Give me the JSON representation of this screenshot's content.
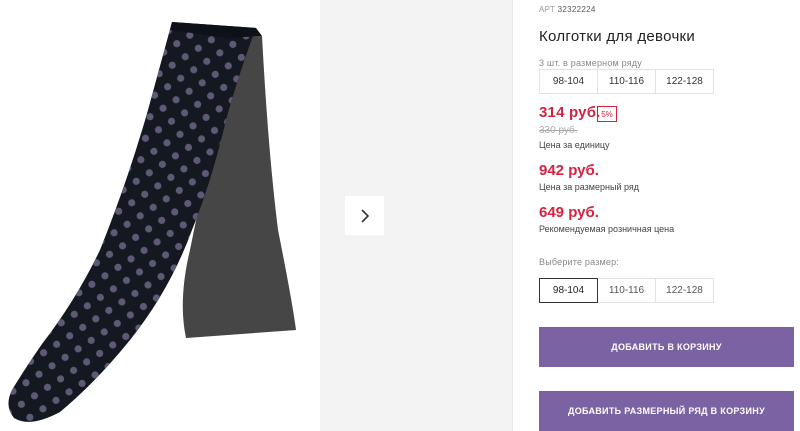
{
  "product": {
    "article_label": "АРТ",
    "article_number": "32322224",
    "title": "Колготки для девочки"
  },
  "series": {
    "label": "3 шт. в размерном ряду",
    "sizes": [
      "98-104",
      "110-116",
      "122-128"
    ]
  },
  "prices": {
    "current": "314 руб.",
    "discount_badge": "5%",
    "old": "330 руб.",
    "unit_label": "Цена за единицу",
    "series_price": "942 руб.",
    "series_price_label": "Цена за размерный ряд",
    "retail_price": "649 руб.",
    "retail_price_label": "Рекомендуемая розничная цена"
  },
  "size_picker": {
    "label": "Выберите размер:",
    "options": [
      "98-104",
      "110-116",
      "122-128"
    ],
    "selected": "98-104"
  },
  "actions": {
    "add_to_cart": "ДОБАВИТЬ В КОРЗИНУ",
    "add_series_to_cart": "ДОБАВИТЬ РАЗМЕРНЫЙ РЯД В КОРЗИНУ"
  },
  "colors": {
    "price": "#d62241",
    "button": "#7b62a3",
    "tights_main": "#141821",
    "tights_inner": "#4a4a4a",
    "dots": "#5e5a75"
  },
  "icons": {
    "gallery_next": "chevron-right-icon"
  }
}
